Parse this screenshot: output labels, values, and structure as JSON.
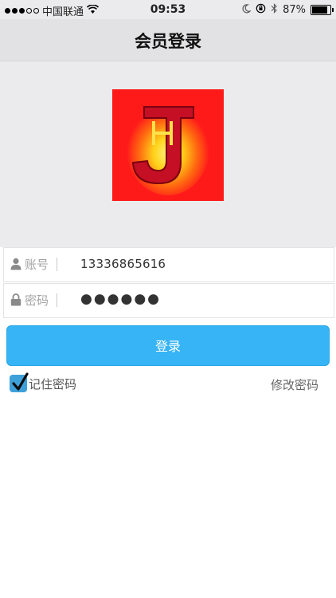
{
  "status_bar": {
    "carrier": "中国联通",
    "time": "09:53",
    "battery": "87%"
  },
  "nav": {
    "title": "会员登录"
  },
  "logo": {
    "accent": "#ff1a1a"
  },
  "form": {
    "account_label": "账号",
    "account_value": "13336865616",
    "password_label": "密码",
    "password_value": "●●●●●●"
  },
  "login_button": {
    "label": "登录",
    "color": "#36b4f5"
  },
  "remember": {
    "label": "记住密码",
    "checked": true
  },
  "change_password": {
    "label": "修改密码"
  }
}
